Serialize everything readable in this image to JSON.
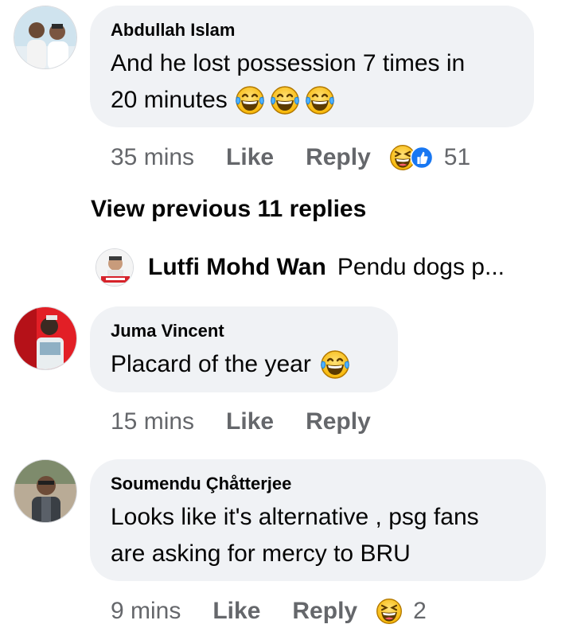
{
  "comments": [
    {
      "author": "Abdullah Islam",
      "text_line1": "And he lost possession 7 times in",
      "text_line2": "20 minutes",
      "time": "35 mins",
      "like": "Like",
      "reply": "Reply",
      "reaction_count": "51",
      "emojis": [
        "laugh-tears-icon",
        "laugh-tears-icon",
        "laugh-tears-icon"
      ],
      "reactions": [
        "haha-reaction-icon",
        "like-reaction-icon"
      ]
    },
    {
      "author": "Juma Vincent",
      "text": "Placard of the year",
      "time": "15 mins",
      "like": "Like",
      "reply": "Reply",
      "emojis": [
        "laugh-tears-icon"
      ]
    },
    {
      "author": "Soumendu Çhåtterjee",
      "text_line1": "Looks like it's alternative , psg fans",
      "text_line2": "are asking for mercy to BRU",
      "time": "9 mins",
      "like": "Like",
      "reply": "Reply",
      "reaction_count": "2",
      "reactions": [
        "haha-reaction-icon"
      ]
    }
  ],
  "view_previous": "View previous 11 replies",
  "collapsed_reply": {
    "author": "Lutfi Mohd Wan",
    "snippet": "Pendu dogs p..."
  },
  "colors": {
    "bubble": "#f0f2f5",
    "meta": "#65676b",
    "text": "#050505",
    "like_blue": "#1877f2",
    "emoji_yellow": "#ffcc4d"
  }
}
